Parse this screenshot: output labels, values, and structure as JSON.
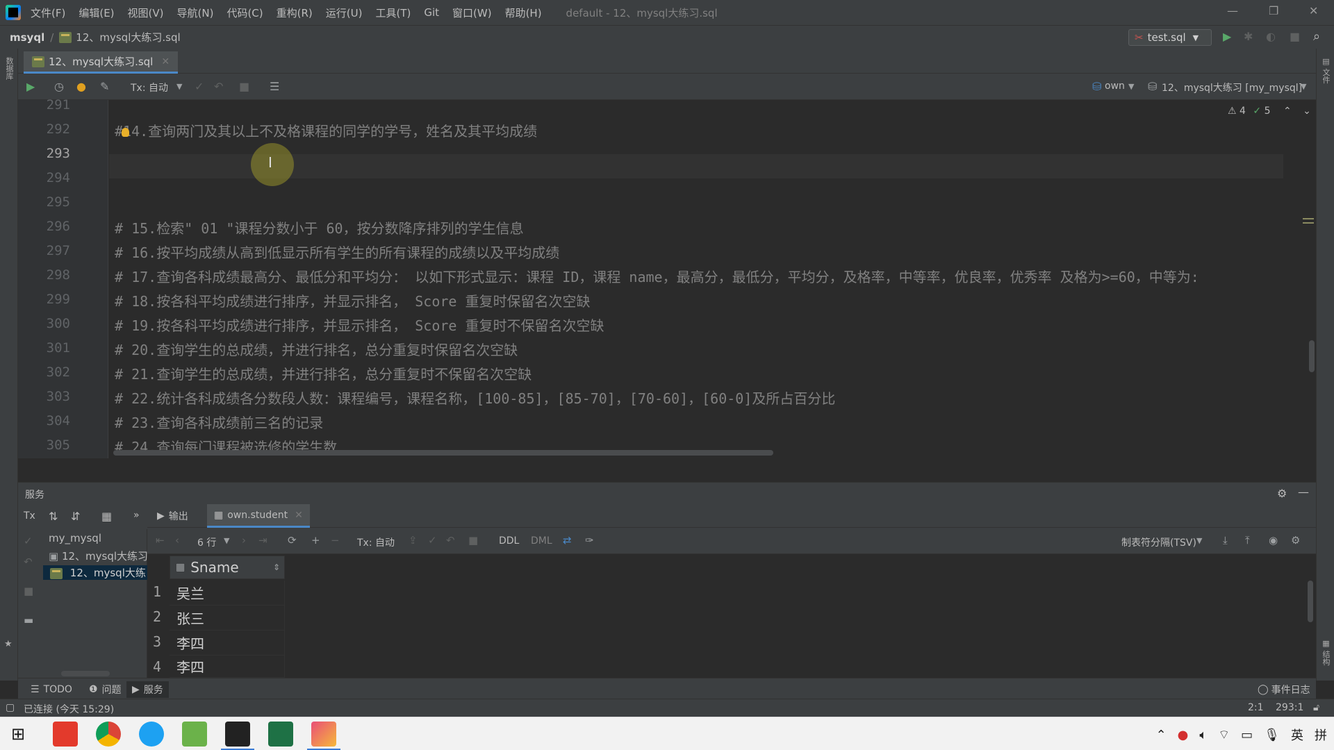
{
  "menubar": {
    "items": [
      "文件(F)",
      "编辑(E)",
      "视图(V)",
      "导航(N)",
      "代码(C)",
      "重构(R)",
      "运行(U)",
      "工具(T)",
      "Git",
      "窗口(W)",
      "帮助(H)"
    ],
    "window_title": "default - 12、mysql大练习.sql"
  },
  "navbar": {
    "root": "msyql",
    "file": "12、mysql大练习.sql",
    "run_config": "test.sql"
  },
  "editor": {
    "tab_label": "12、mysql大练习.sql",
    "tx_mode": "Tx: 自动",
    "schema_selector": "own",
    "datasource_selector": "12、mysql大练习 [my_mysql]",
    "inspections": {
      "warnings": "4",
      "ok": "5"
    },
    "current_line": "293",
    "lines": [
      {
        "num": "291",
        "text": ""
      },
      {
        "num": "292",
        "text": "#14.查询两门及其以上不及格课程的同学的学号，姓名及其平均成绩"
      },
      {
        "num": "293",
        "text": ""
      },
      {
        "num": "294",
        "text": ""
      },
      {
        "num": "295",
        "text": ""
      },
      {
        "num": "296",
        "text": "# 15.检索\" 01 \"课程分数小于 60，按分数降序排列的学生信息"
      },
      {
        "num": "297",
        "text": "# 16.按平均成绩从高到低显示所有学生的所有课程的成绩以及平均成绩"
      },
      {
        "num": "298",
        "text": "# 17.查询各科成绩最高分、最低分和平均分： 以如下形式显示：课程 ID，课程 name，最高分，最低分，平均分，及格率，中等率，优良率，优秀率 及格为>=60，中等为:"
      },
      {
        "num": "299",
        "text": "# 18.按各科平均成绩进行排序，并显示排名， Score 重复时保留名次空缺"
      },
      {
        "num": "300",
        "text": "# 19.按各科平均成绩进行排序，并显示排名， Score 重复时不保留名次空缺"
      },
      {
        "num": "301",
        "text": "# 20.查询学生的总成绩，并进行排名，总分重复时保留名次空缺"
      },
      {
        "num": "302",
        "text": "# 21.查询学生的总成绩，并进行排名，总分重复时不保留名次空缺"
      },
      {
        "num": "303",
        "text": "# 22.统计各科成绩各分数段人数：课程编号，课程名称，[100-85]，[85-70]，[70-60]，[60-0]及所占百分比"
      },
      {
        "num": "304",
        "text": "# 23.查询各科成绩前三名的记录"
      },
      {
        "num": "305",
        "text": "# 24.查询每门课程被选修的学生数"
      }
    ]
  },
  "services": {
    "title": "服务",
    "tree": {
      "root": "my_mysql",
      "child": "12、mysql大练习",
      "grandchild": "12、mysql大练"
    },
    "tabs": {
      "output": "输出",
      "table": "own.student"
    },
    "toolbar": {
      "rows": "6 行",
      "tx_mode": "Tx: 自动",
      "ddl": "DDL",
      "dml": "DML",
      "export_format": "制表符分隔(TSV)"
    },
    "grid": {
      "column": "Sname",
      "rows": [
        {
          "num": "1",
          "value": "吴兰"
        },
        {
          "num": "2",
          "value": "张三"
        },
        {
          "num": "3",
          "value": "李四"
        },
        {
          "num": "4",
          "value": "李四"
        }
      ]
    }
  },
  "bottom_tabs": {
    "todo": "TODO",
    "problems": "问题",
    "services": "服务",
    "event_log": "事件日志"
  },
  "statusbar": {
    "text": "已连接 (今天 15:29)",
    "pos_a": "2:1",
    "pos_b": "293:1"
  },
  "taskbar": {
    "tray_ime": "英",
    "tray_layout": "拼"
  },
  "colors": {
    "accent": "#4a88c7",
    "comment": "#808080",
    "background": "#2b2b2b",
    "panel": "#3c3f41"
  }
}
